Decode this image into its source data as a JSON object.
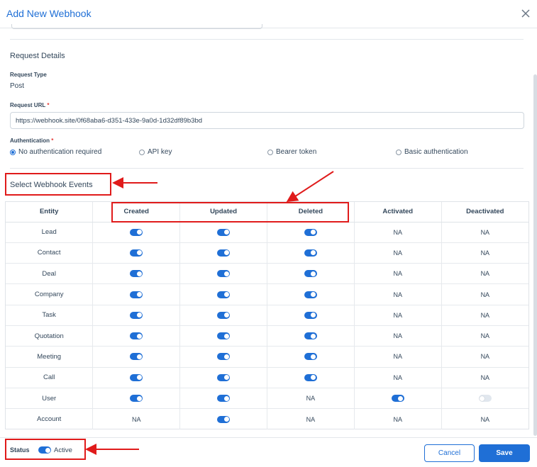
{
  "dialog": {
    "title": "Add New Webhook",
    "close_icon": "close-icon"
  },
  "request": {
    "section_title": "Request Details",
    "type_label": "Request Type",
    "type_value": "Post",
    "url_label": "Request URL",
    "url_required": "*",
    "url_value": "https://webhook.site/0f68aba6-d351-433e-9a0d-1d32df89b3bd",
    "auth_label": "Authentication",
    "auth_required": "*",
    "auth_options": [
      {
        "label": "No authentication required",
        "selected": true
      },
      {
        "label": "API key",
        "selected": false
      },
      {
        "label": "Bearer token",
        "selected": false
      },
      {
        "label": "Basic authentication",
        "selected": false
      }
    ]
  },
  "events": {
    "section_title": "Select Webhook Events",
    "columns": [
      "Entity",
      "Created",
      "Updated",
      "Deleted",
      "Activated",
      "Deactivated"
    ],
    "rows": [
      {
        "entity": "Lead",
        "cells": [
          "on",
          "on",
          "on",
          "NA",
          "NA"
        ]
      },
      {
        "entity": "Contact",
        "cells": [
          "on",
          "on",
          "on",
          "NA",
          "NA"
        ]
      },
      {
        "entity": "Deal",
        "cells": [
          "on",
          "on",
          "on",
          "NA",
          "NA"
        ]
      },
      {
        "entity": "Company",
        "cells": [
          "on",
          "on",
          "on",
          "NA",
          "NA"
        ]
      },
      {
        "entity": "Task",
        "cells": [
          "on",
          "on",
          "on",
          "NA",
          "NA"
        ]
      },
      {
        "entity": "Quotation",
        "cells": [
          "on",
          "on",
          "on",
          "NA",
          "NA"
        ]
      },
      {
        "entity": "Meeting",
        "cells": [
          "on",
          "on",
          "on",
          "NA",
          "NA"
        ]
      },
      {
        "entity": "Call",
        "cells": [
          "on",
          "on",
          "on",
          "NA",
          "NA"
        ]
      },
      {
        "entity": "User",
        "cells": [
          "on",
          "on",
          "NA",
          "on",
          "off"
        ]
      },
      {
        "entity": "Account",
        "cells": [
          "NA",
          "on",
          "NA",
          "NA",
          "NA"
        ]
      }
    ]
  },
  "footer": {
    "status_label": "Status",
    "status_value": "Active",
    "status_on": true,
    "cancel_label": "Cancel",
    "save_label": "Save"
  },
  "colors": {
    "accent": "#1f6fd6",
    "annotation": "#e01b1b",
    "text": "#33475b"
  }
}
